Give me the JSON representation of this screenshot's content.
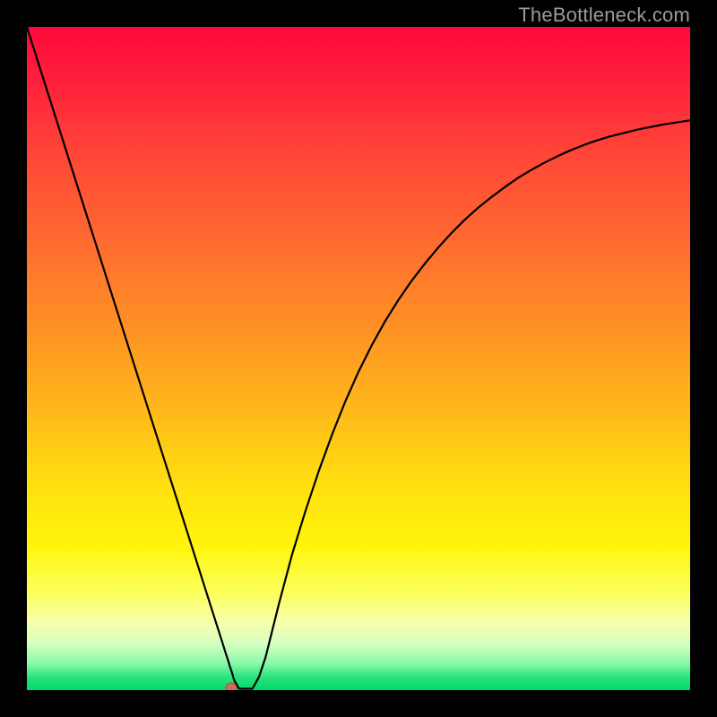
{
  "watermark": {
    "text": "TheBottleneck.com"
  },
  "chart_data": {
    "type": "line",
    "title": "",
    "xlabel": "",
    "ylabel": "",
    "xlim": [
      0,
      100
    ],
    "ylim": [
      0,
      100
    ],
    "grid": false,
    "legend": false,
    "series": [
      {
        "name": "curve",
        "x": [
          0,
          2,
          4,
          6,
          8,
          10,
          12,
          14,
          16,
          18,
          20,
          22,
          24,
          26,
          28,
          29.5,
          30,
          30.3,
          30.6,
          31,
          31.1,
          31.3,
          32.0,
          32.0,
          32.5,
          33,
          34,
          35,
          36,
          37,
          38,
          40,
          42,
          44,
          46,
          48,
          50,
          52,
          54,
          56,
          58,
          60,
          62,
          64,
          66,
          68,
          70,
          72,
          74,
          76,
          78,
          80,
          82,
          84,
          86,
          88,
          90,
          92,
          94,
          96,
          98,
          100
        ],
        "y": [
          100.0,
          93.7,
          87.4,
          81.1,
          74.8,
          68.5,
          62.2,
          55.9,
          49.6,
          43.3,
          37.0,
          30.7,
          24.4,
          18.1,
          11.8,
          7.1,
          5.5,
          4.6,
          3.6,
          2.4,
          2.0,
          1.4,
          0.2,
          0.2,
          0.2,
          0.2,
          0.2,
          2.0,
          5.0,
          9.0,
          13.0,
          20.5,
          27.0,
          33.0,
          38.5,
          43.5,
          48.0,
          52.0,
          55.6,
          58.8,
          61.7,
          64.3,
          66.7,
          68.9,
          70.9,
          72.7,
          74.3,
          75.8,
          77.2,
          78.4,
          79.5,
          80.5,
          81.4,
          82.2,
          82.9,
          83.5,
          84.0,
          84.5,
          84.9,
          85.3,
          85.6,
          85.9
        ]
      }
    ],
    "marker": {
      "x": 30.8,
      "y": 0.4
    },
    "background": {
      "type": "vertical-gradient",
      "stops": [
        {
          "pos": 0.0,
          "color": "#ff0a3a"
        },
        {
          "pos": 0.18,
          "color": "#ff4238"
        },
        {
          "pos": 0.46,
          "color": "#ff9324"
        },
        {
          "pos": 0.68,
          "color": "#ffdc10"
        },
        {
          "pos": 0.85,
          "color": "#fcff58"
        },
        {
          "pos": 0.93,
          "color": "#d6ffc0"
        },
        {
          "pos": 1.0,
          "color": "#00d968"
        }
      ]
    }
  },
  "colors": {
    "page_bg": "#000000",
    "curve": "#000000",
    "marker_fill": "#d46a5a",
    "marker_stroke": "#b04a3c",
    "watermark": "#9b9b9b"
  }
}
